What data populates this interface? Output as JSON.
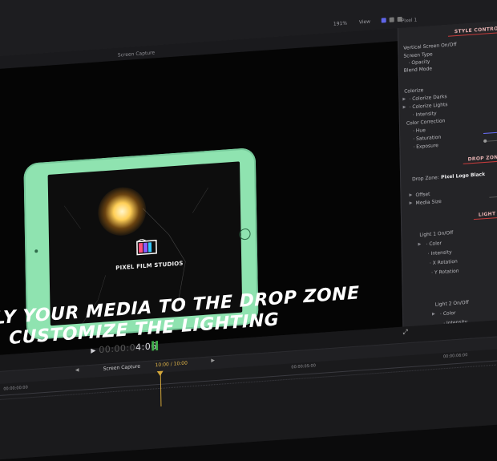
{
  "toolbar": {
    "zoom": "191%",
    "view": "View",
    "viewer_title": "Screen Capture",
    "pixel_label": "Pixel 1"
  },
  "viewer": {
    "brand": "PIXEL FILM STUDIOS",
    "caption_line1": "LY YOUR MEDIA TO THE DROP ZONE",
    "caption_line2": "CUSTOMIZE THE LIGHTING"
  },
  "inspector": {
    "style_controls": "STYLE CONTROLS",
    "vertical_screen": "Vertical Screen On/Off",
    "screen_type": "Screen Type",
    "opacity": "· Opacity",
    "blend_mode": "Blend Mode",
    "colorize": "Colorize",
    "colorize_darks": "· Colorize Darks",
    "colorize_lights": "· Colorize Lights",
    "intensity": "· Intensity",
    "color_correction": "Color Correction",
    "hue": "· Hue",
    "saturation": "· Saturation",
    "exposure": "· Exposure",
    "drop_zone_controls": "DROP ZONE CO",
    "drop_zone_label": "Drop Zone:",
    "drop_zone_value": "Pixel Logo Black",
    "offset": "Offset",
    "media_size": "Media Size",
    "light_controls": "LIGHT CONT",
    "light1": "Light 1 On/Off",
    "light1_color": "· Color",
    "light1_intensity": "· Intensity",
    "light1_xrot": "· X Rotation",
    "light1_yrot": "· Y Rotation",
    "light2": "Light 2 On/Off",
    "light2_color": "· Color",
    "light2_intensity": "· Intensity"
  },
  "transport": {
    "timecode_dim": "00:00:0",
    "timecode": "4:06"
  },
  "timeline": {
    "project": "Screen Capture",
    "duration": "10:00 / 10:00",
    "ticks": [
      "00:00:00:00",
      "00:00:05:00",
      "00:00:06:00"
    ]
  },
  "colors": {
    "tablet": "#8fe3b0",
    "accent_red": "#c83c3c",
    "playhead": "#d2a63a"
  }
}
